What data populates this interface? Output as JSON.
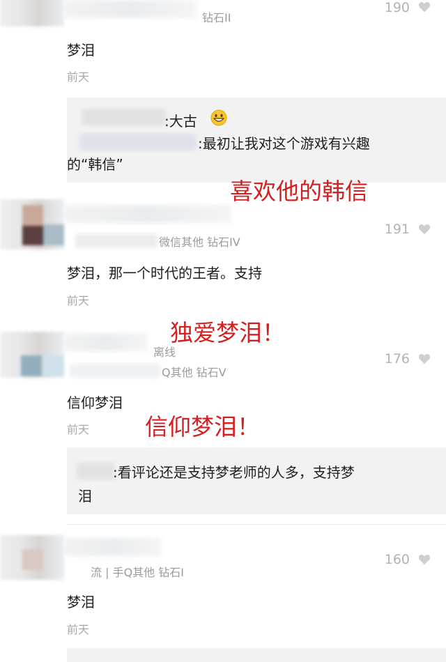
{
  "comments": [
    {
      "username_meta": "钻石II",
      "like_count": "190",
      "text": "梦泪",
      "date": "前天",
      "reply": {
        "line1": ":大古",
        "line2": ":最初让我对这个游戏有兴趣",
        "line3": "的“韩信”"
      }
    },
    {
      "username_meta": "微信其他  钻石IV",
      "like_count": "191",
      "text": "梦泪，那一个时代的王者。支持",
      "date": "前天"
    },
    {
      "username_status": "离线",
      "username_meta": "Q其他  钻石V",
      "like_count": "176",
      "text": "信仰梦泪",
      "date": "前天",
      "reply": {
        "line1": ":看评论还是支持梦老师的人多，支持梦",
        "line2": "泪"
      }
    },
    {
      "username_meta": "流 | 手Q其他  钻石I",
      "like_count": "160",
      "text": "梦泪",
      "date": "前天"
    }
  ],
  "overlays": {
    "one": "喜欢他的韩信",
    "two": "独爱梦泪！",
    "three": "信仰梦泪！"
  },
  "icons": {
    "like": "heart-icon",
    "emoji": "grinning-face-emoji"
  },
  "colors": {
    "overlay": "#d42020",
    "reply_bg": "#f2f2f2",
    "muted": "#a8a8a8"
  }
}
